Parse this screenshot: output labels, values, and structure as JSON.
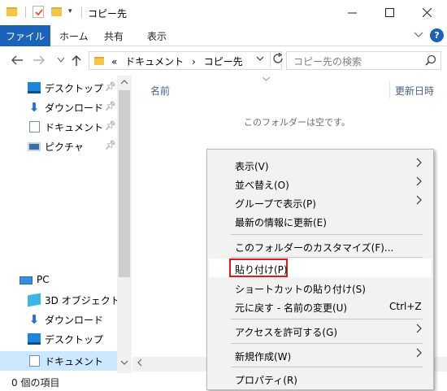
{
  "window": {
    "title": "コピー先",
    "quick_access_dropdown": "▾"
  },
  "ribbon": {
    "tabs": [
      "ファイル",
      "ホーム",
      "共有",
      "表示"
    ]
  },
  "address": {
    "overflow": "«",
    "path": [
      "ドキュメント",
      "コピー先"
    ],
    "separator": "›",
    "search_placeholder": "コピー先の検索"
  },
  "nav_pane": {
    "quick_access": [
      {
        "label": "デスクトップ",
        "icon": "desktop-icon",
        "pinned": true
      },
      {
        "label": "ダウンロード",
        "icon": "download-icon",
        "pinned": true
      },
      {
        "label": "ドキュメント",
        "icon": "document-icon",
        "pinned": true
      },
      {
        "label": "ピクチャ",
        "icon": "picture-icon",
        "pinned": true
      }
    ],
    "this_pc": {
      "label": "PC",
      "icon": "pc-icon"
    },
    "pc_items": [
      {
        "label": "3D オブジェクト",
        "icon": "3d-objects-icon"
      },
      {
        "label": "ダウンロード",
        "icon": "download-icon"
      },
      {
        "label": "デスクトップ",
        "icon": "desktop-icon"
      },
      {
        "label": "ドキュメント",
        "icon": "document-icon",
        "selected": true
      }
    ]
  },
  "content": {
    "columns": [
      "名前",
      "更新日時"
    ],
    "empty_message": "このフォルダーは空です。"
  },
  "status": {
    "text": "0 個の項目"
  },
  "context_menu": {
    "items": [
      {
        "label": "表示(V)",
        "submenu": true
      },
      {
        "label": "並べ替え(O)",
        "submenu": true
      },
      {
        "label": "グループで表示(P)",
        "submenu": true
      },
      {
        "label": "最新の情報に更新(E)"
      },
      {
        "label": "このフォルダーのカスタマイズ(F)..."
      },
      {
        "label": "貼り付け(P)",
        "highlighted": true
      },
      {
        "label": "ショートカットの貼り付け(S)"
      },
      {
        "label": "元に戻す - 名前の変更(U)",
        "shortcut": "Ctrl+Z"
      },
      {
        "label": "アクセスを許可する(G)",
        "submenu": true
      },
      {
        "label": "新規作成(W)",
        "submenu": true
      },
      {
        "label": "プロパティ(R)"
      }
    ]
  },
  "colors": {
    "accent": "#1a63b8",
    "highlight_box": "#e0191b",
    "selection": "#cce8ff"
  }
}
